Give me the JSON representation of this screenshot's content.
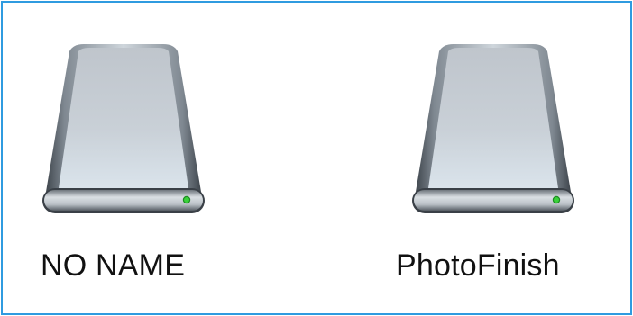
{
  "desktop": {
    "items": [
      {
        "label": "NO NAME",
        "icon": "external-drive-icon",
        "status_led": "#39d23a"
      },
      {
        "label": "PhotoFinish",
        "icon": "external-drive-icon",
        "status_led": "#39d23a"
      }
    ]
  },
  "colors": {
    "selection_border": "#2f9be0",
    "background": "#ffffff"
  }
}
